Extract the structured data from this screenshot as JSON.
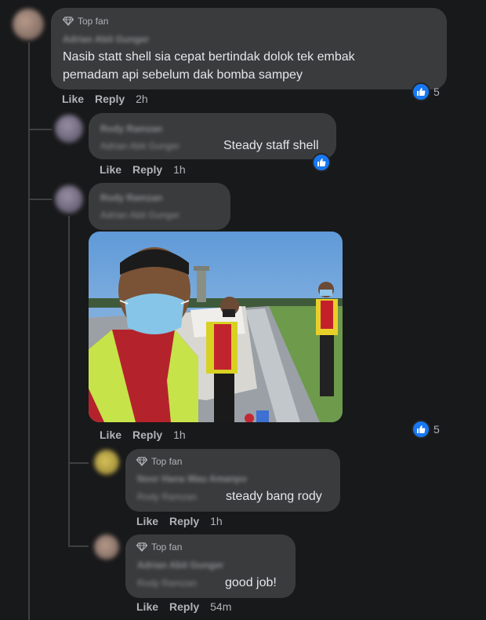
{
  "badge_label": "Top fan",
  "comments": [
    {
      "author": "Adrian Abit Gunger",
      "text_lines": [
        "Nasib statt shell sia cepat bertindak dolok tek embak",
        "pemadam api sebelum dak bomba sampey"
      ],
      "actions": {
        "like": "Like",
        "reply": "Reply",
        "time": "2h"
      },
      "reaction_count": "5"
    },
    {
      "author": "Rody Ramzan",
      "mention": "Adrian Abit Gunger",
      "text": "Steady staff shell",
      "actions": {
        "like": "Like",
        "reply": "Reply",
        "time": "1h"
      }
    },
    {
      "author": "Rody Ramzan",
      "mention": "Adrian Abit Gunger",
      "text": "",
      "actions": {
        "like": "Like",
        "reply": "Reply",
        "time": "1h"
      },
      "reaction_count": "5"
    },
    {
      "author": "Noor Hana Wau Amanpo",
      "mention": "Rody Ramzan",
      "text": "steady bang rody",
      "actions": {
        "like": "Like",
        "reply": "Reply",
        "time": "1h"
      }
    },
    {
      "author": "Adrian Abit Gunger",
      "mention": "Rody Ramzan",
      "text": "good job!",
      "actions": {
        "like": "Like",
        "reply": "Reply",
        "time": "54m"
      }
    }
  ],
  "colors": {
    "background": "#18191a",
    "bubble": "#3a3b3c",
    "like_blue": "#1877f2",
    "meta_text": "#b0b3b8"
  },
  "icons": [
    "diamond-icon",
    "like-thumb-icon",
    "avatar"
  ]
}
